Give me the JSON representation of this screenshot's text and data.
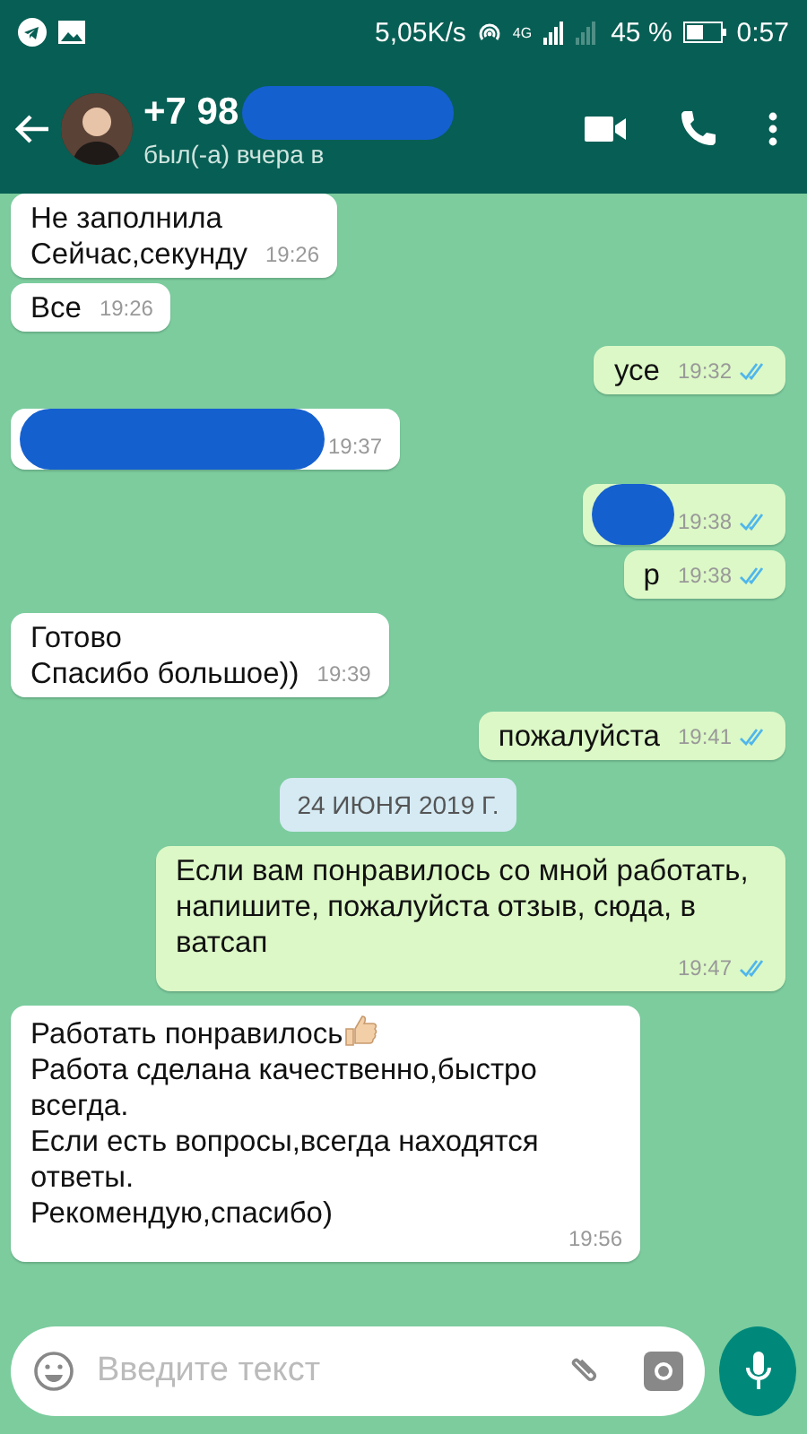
{
  "status_bar": {
    "speed": "5,05K/s",
    "network": "4G",
    "battery": "45 %",
    "time": "0:57"
  },
  "header": {
    "title": "+7 98",
    "title_redacted": true,
    "subtitle": "был(-а) вчера в"
  },
  "messages": [
    {
      "kind": "in",
      "lines": [
        "Не заполнила",
        "Сейчас,секунду"
      ],
      "time": "19:26"
    },
    {
      "kind": "in",
      "lines": [
        "Все"
      ],
      "time": "19:26"
    },
    {
      "kind": "out",
      "lines": [
        "усе"
      ],
      "time": "19:32",
      "read": true
    },
    {
      "kind": "in",
      "redacted": true,
      "time": "19:37"
    },
    {
      "kind": "out",
      "redacted": true,
      "time": "19:38",
      "read": true
    },
    {
      "kind": "out",
      "lines": [
        "р"
      ],
      "time": "19:38",
      "read": true
    },
    {
      "kind": "in",
      "lines": [
        "Готово",
        "Спасибо большое))"
      ],
      "time": "19:39"
    },
    {
      "kind": "out",
      "lines": [
        "пожалуйста"
      ],
      "time": "19:41",
      "read": true
    },
    {
      "kind": "date",
      "lines": [
        "24 ИЮНЯ 2019 Г."
      ]
    },
    {
      "kind": "out",
      "lines": [
        "Если вам понравилось со мной работать, напишите, пожалуйста отзыв, сюда, в ватсап"
      ],
      "time": "19:47",
      "read": true
    },
    {
      "kind": "in",
      "lines": [
        "Работать понравилось",
        "Работа сделана качественно,быстро всегда.",
        "Если есть вопросы,всегда находятся ответы.",
        "Рекомендую,спасибо)"
      ],
      "thumbs_up": true,
      "time": "19:56"
    }
  ],
  "composer": {
    "placeholder": "Введите текст"
  }
}
